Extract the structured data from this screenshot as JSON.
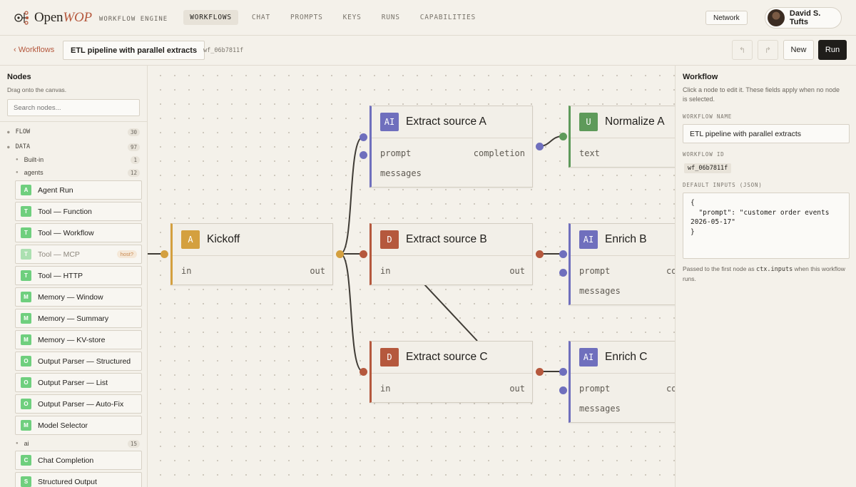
{
  "brand": {
    "name_a": "Open",
    "name_b": "WOP",
    "subtitle": "WORKFLOW ENGINE"
  },
  "nav": {
    "tabs": [
      "WORKFLOWS",
      "CHAT",
      "PROMPTS",
      "KEYS",
      "RUNS",
      "CAPABILITIES"
    ],
    "active": "WORKFLOWS"
  },
  "header": {
    "network_label": "Network",
    "user_name": "David S. Tufts"
  },
  "toolbar": {
    "back_label": "‹ Workflows",
    "workflow_name": "ETL pipeline with parallel extracts",
    "workflow_id": "wf_06b7811f",
    "undo_icon": "↰",
    "redo_icon": "↱",
    "new_label": "New",
    "run_label": "Run"
  },
  "sidebar": {
    "title": "Nodes",
    "hint": "Drag onto the canvas.",
    "search_placeholder": "Search nodes...",
    "categories": [
      {
        "label": "FLOW",
        "count": "30"
      },
      {
        "label": "DATA",
        "count": "97"
      }
    ],
    "subgroups": [
      {
        "label": "Built-in",
        "count": "1"
      },
      {
        "label": "agents",
        "count": "12"
      },
      {
        "label": "ai",
        "count": "15"
      }
    ],
    "items": [
      {
        "badge": "A",
        "label": "Agent Run"
      },
      {
        "badge": "T",
        "label": "Tool — Function"
      },
      {
        "badge": "T",
        "label": "Tool — Workflow"
      },
      {
        "badge": "T",
        "label": "Tool — MCP",
        "tag": "host?"
      },
      {
        "badge": "T",
        "label": "Tool — HTTP"
      },
      {
        "badge": "M",
        "label": "Memory — Window"
      },
      {
        "badge": "M",
        "label": "Memory — Summary"
      },
      {
        "badge": "M",
        "label": "Memory — KV-store"
      },
      {
        "badge": "O",
        "label": "Output Parser — Structured"
      },
      {
        "badge": "O",
        "label": "Output Parser — List"
      },
      {
        "badge": "O",
        "label": "Output Parser — Auto-Fix"
      },
      {
        "badge": "M",
        "label": "Model Selector"
      },
      {
        "badge": "C",
        "label": "Chat Completion"
      },
      {
        "badge": "S",
        "label": "Structured Output"
      }
    ]
  },
  "canvas": {
    "nodes": [
      {
        "id": "kickoff",
        "badge": "A",
        "title": "Kickoff",
        "color": "#d4a03f",
        "ports": [
          "in",
          "out"
        ]
      },
      {
        "id": "extract_a",
        "badge": "AI",
        "title": "Extract source A",
        "color": "#6f6fbd",
        "ports": [
          "prompt",
          "completion",
          "messages"
        ]
      },
      {
        "id": "extract_b",
        "badge": "D",
        "title": "Extract source B",
        "color": "#b5583d",
        "ports": [
          "in",
          "out"
        ]
      },
      {
        "id": "extract_c",
        "badge": "D",
        "title": "Extract source C",
        "color": "#b5583d",
        "ports": [
          "in",
          "out"
        ]
      },
      {
        "id": "normalize_a",
        "badge": "U",
        "title": "Normalize A",
        "color": "#5e9a5a",
        "ports": [
          "text"
        ]
      },
      {
        "id": "enrich_b",
        "badge": "AI",
        "title": "Enrich B",
        "color": "#6f6fbd",
        "ports": [
          "prompt",
          "co",
          "messages"
        ]
      },
      {
        "id": "enrich_c",
        "badge": "AI",
        "title": "Enrich C",
        "color": "#6f6fbd",
        "ports": [
          "prompt",
          "co",
          "messages"
        ]
      }
    ]
  },
  "panel": {
    "title": "Workflow",
    "hint": "Click a node to edit it. These fields apply when no node is selected.",
    "name_label": "WORKFLOW NAME",
    "name_value": "ETL pipeline with parallel extracts",
    "id_label": "WORKFLOW ID",
    "id_value": "wf_06b7811f",
    "inputs_label": "DEFAULT INPUTS (JSON)",
    "inputs_value": "{\n  \"prompt\": \"customer order events\n2026-05-17\"\n}",
    "foot_a": "Passed to the first node as ",
    "foot_code": "ctx.inputs",
    "foot_b": " when this workflow runs."
  }
}
